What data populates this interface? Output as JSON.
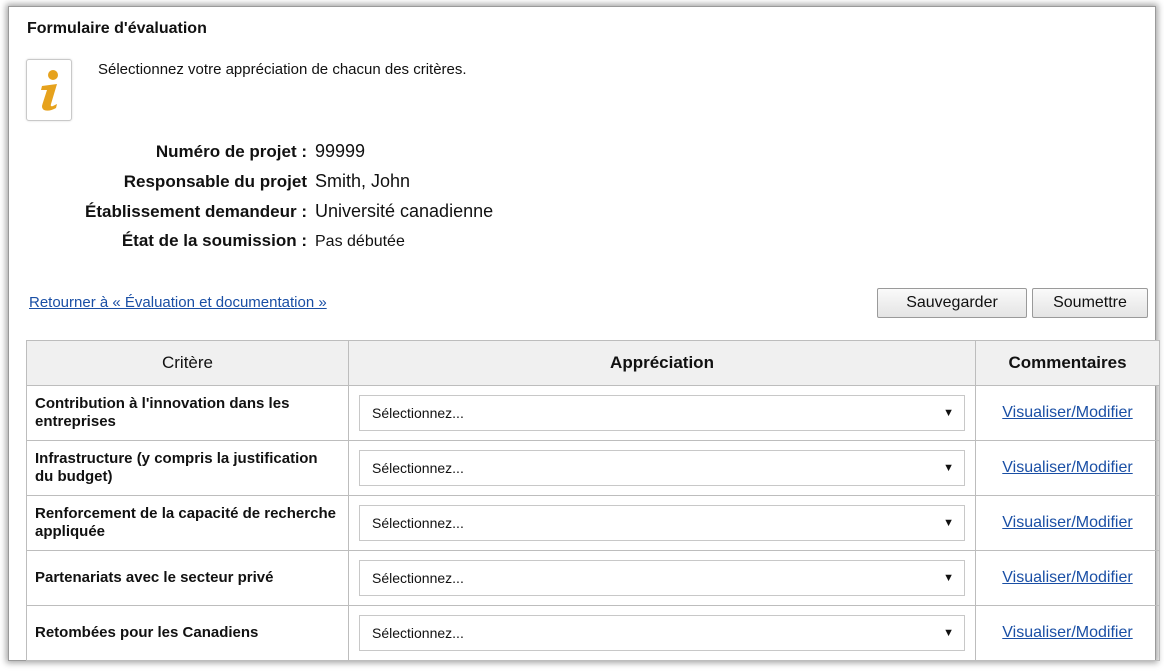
{
  "form": {
    "title": "Formulaire d'évaluation",
    "instruction": "Sélectionnez votre appréciation de chacun des critères.",
    "info_icon": "info-icon"
  },
  "project": {
    "number_label": "Numéro de projet :",
    "number_value": "99999",
    "lead_label": "Responsable du projet",
    "lead_value": "Smith, John",
    "institution_label": "Établissement demandeur :",
    "institution_value": "Université canadienne",
    "status_label": "État de la soumission :",
    "status_value": "Pas débutée"
  },
  "actions": {
    "back_link": "Retourner à « Évaluation et documentation »",
    "save": "Sauvegarder",
    "submit": "Soumettre"
  },
  "table": {
    "headers": {
      "criterion": "Critère",
      "rating": "Appréciation",
      "comments": "Commentaires"
    },
    "rows": [
      {
        "criterion": "Contribution à l'innovation dans les entreprises",
        "rating": "Sélectionnez...",
        "comments": "Visualiser/Modifier"
      },
      {
        "criterion": "Infrastructure (y compris la justification du budget)",
        "rating": "Sélectionnez...",
        "comments": "Visualiser/Modifier"
      },
      {
        "criterion": "Renforcement de la capacité de recherche appliquée",
        "rating": "Sélectionnez...",
        "comments": "Visualiser/Modifier"
      },
      {
        "criterion": "Partenariats avec le secteur privé",
        "rating": "Sélectionnez...",
        "comments": "Visualiser/Modifier"
      },
      {
        "criterion": "Retombées pour les Canadiens",
        "rating": "Sélectionnez...",
        "comments": "Visualiser/Modifier"
      }
    ],
    "dropdown_icon": "dropdown-arrow-icon"
  }
}
